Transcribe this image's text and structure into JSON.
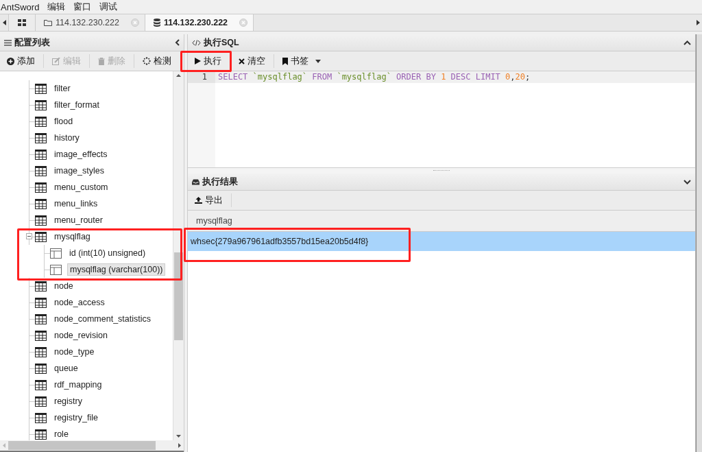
{
  "menu": [
    "AntSword",
    "编辑",
    "窗口",
    "调试"
  ],
  "tabs": [
    {
      "kind": "home",
      "selected": false
    },
    {
      "kind": "folder",
      "label": "114.132.230.222",
      "selected": false
    },
    {
      "kind": "database",
      "label": "114.132.230.222",
      "selected": true
    }
  ],
  "sidebar": {
    "title": "配置列表",
    "toolbar": [
      {
        "kind": "add",
        "label": "添加",
        "disabled": false
      },
      {
        "kind": "edit",
        "label": "编辑",
        "disabled": true
      },
      {
        "kind": "delete",
        "label": "删除",
        "disabled": true
      },
      {
        "kind": "check",
        "label": "检测",
        "disabled": false
      }
    ],
    "tree": [
      {
        "name": "filter"
      },
      {
        "name": "filter_format"
      },
      {
        "name": "flood"
      },
      {
        "name": "history"
      },
      {
        "name": "image_effects"
      },
      {
        "name": "image_styles"
      },
      {
        "name": "menu_custom"
      },
      {
        "name": "menu_links"
      },
      {
        "name": "menu_router"
      },
      {
        "name": "mysqlflag",
        "expanded": true,
        "children": [
          {
            "name": "id (int(10) unsigned)",
            "selected": false
          },
          {
            "name": "mysqlflag (varchar(100))",
            "selected": true
          }
        ]
      },
      {
        "name": "node"
      },
      {
        "name": "node_access"
      },
      {
        "name": "node_comment_statistics"
      },
      {
        "name": "node_revision"
      },
      {
        "name": "node_type"
      },
      {
        "name": "queue"
      },
      {
        "name": "rdf_mapping"
      },
      {
        "name": "registry"
      },
      {
        "name": "registry_file"
      },
      {
        "name": "role"
      }
    ]
  },
  "sql_panel": {
    "title": "执行SQL",
    "toolbar": [
      {
        "kind": "run",
        "label": "执行"
      },
      {
        "kind": "clear",
        "label": "清空"
      },
      {
        "kind": "bookmark",
        "label": "书签"
      }
    ],
    "editor": {
      "line_number": "1",
      "tokens": [
        {
          "kind": "keyword",
          "text": "SELECT"
        },
        {
          "kind": "ident",
          "text": " `mysqlflag` "
        },
        {
          "kind": "keyword",
          "text": "FROM"
        },
        {
          "kind": "ident",
          "text": " `mysqlflag` "
        },
        {
          "kind": "keyword",
          "text": "ORDER BY "
        },
        {
          "kind": "number",
          "text": "1"
        },
        {
          "kind": "keyword",
          "text": " DESC LIMIT "
        },
        {
          "kind": "number",
          "text": "0"
        },
        {
          "kind": "punct",
          "text": ","
        },
        {
          "kind": "number",
          "text": "20"
        },
        {
          "kind": "punct",
          "text": ";"
        }
      ]
    }
  },
  "result_panel": {
    "title": "执行结果",
    "toolbar": [
      {
        "kind": "export",
        "label": "导出"
      }
    ],
    "table": {
      "columns": [
        "mysqlflag"
      ],
      "rows": [
        {
          "cells": [
            "whsec{279a967961adfb3557bd15ea20b5d4f8}"
          ],
          "selected": true
        }
      ]
    }
  }
}
